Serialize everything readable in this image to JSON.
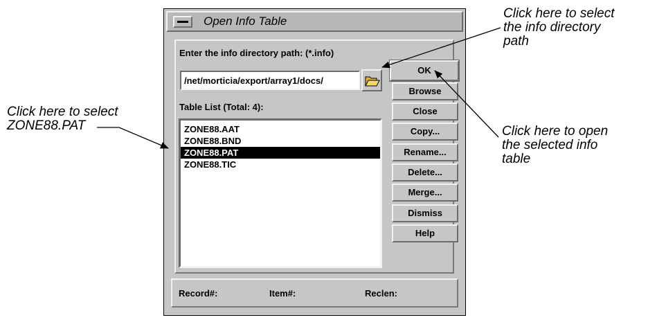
{
  "callouts": {
    "select_dir": "Click here to select\nthe info directory\npath",
    "select_file": "Click here to select\nZONE88.PAT",
    "open_table": "Click here to open\nthe selected info\ntable"
  },
  "dialog": {
    "title": "Open Info Table",
    "path_label": "Enter the info directory path: (*.info)",
    "path_value": "/net/morticia/export/array1/docs/",
    "folder_icon": "folder-open-icon",
    "list_label": "Table List (Total: 4):",
    "table_list": [
      "ZONE88.AAT",
      "ZONE88.BND",
      "ZONE88.PAT",
      "ZONE88.TIC"
    ],
    "selected_index": 2,
    "buttons": {
      "ok": "OK",
      "browse": "Browse",
      "close": "Close",
      "copy": "Copy...",
      "rename": "Rename...",
      "delete": "Delete...",
      "merge": "Merge...",
      "dismiss": "Dismiss",
      "help": "Help"
    },
    "status": {
      "record": "Record#:",
      "item": "Item#:",
      "reclen": "Reclen:"
    }
  }
}
